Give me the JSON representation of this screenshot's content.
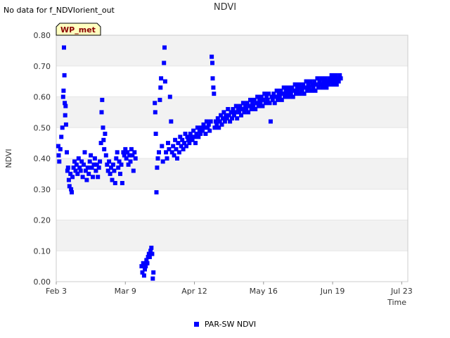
{
  "header": {
    "nodata_text": "No data for f_NDVIorient_out",
    "title": "NDVI"
  },
  "badge": {
    "label": "WP_met"
  },
  "legend": {
    "label": "PAR-SW NDVI",
    "color": "#0000ff"
  },
  "chart_data": {
    "type": "scatter",
    "title": "NDVI",
    "xlabel": "Time",
    "ylabel": "NDVI",
    "ylim": [
      0,
      0.8
    ],
    "yticks": [
      "0.00",
      "0.10",
      "0.20",
      "0.30",
      "0.40",
      "0.50",
      "0.60",
      "0.70",
      "0.80"
    ],
    "xlim_days_from_feb3": [
      0,
      173
    ],
    "xticks": [
      {
        "label": "Feb 3",
        "day": 0
      },
      {
        "label": "Mar 9",
        "day": 34
      },
      {
        "label": "Apr 12",
        "day": 68
      },
      {
        "label": "May 16",
        "day": 102
      },
      {
        "label": "Jun 19",
        "day": 136
      },
      {
        "label": "Jul 23",
        "day": 170
      }
    ],
    "grid": "horizontal bands",
    "series": [
      {
        "name": "PAR-SW NDVI",
        "color": "#0000ff",
        "points": [
          [
            1.0,
            0.44
          ],
          [
            1.2,
            0.41
          ],
          [
            1.5,
            0.39
          ],
          [
            2.0,
            0.43
          ],
          [
            2.5,
            0.47
          ],
          [
            3.0,
            0.5
          ],
          [
            3.4,
            0.6
          ],
          [
            3.6,
            0.62
          ],
          [
            3.8,
            0.76
          ],
          [
            4.0,
            0.67
          ],
          [
            4.2,
            0.58
          ],
          [
            4.4,
            0.54
          ],
          [
            4.6,
            0.57
          ],
          [
            4.8,
            0.51
          ],
          [
            5.2,
            0.42
          ],
          [
            5.5,
            0.36
          ],
          [
            5.8,
            0.37
          ],
          [
            6.2,
            0.33
          ],
          [
            6.5,
            0.31
          ],
          [
            7.0,
            0.35
          ],
          [
            7.3,
            0.3
          ],
          [
            7.6,
            0.29
          ],
          [
            8.0,
            0.34
          ],
          [
            8.5,
            0.37
          ],
          [
            9.0,
            0.39
          ],
          [
            9.5,
            0.36
          ],
          [
            10,
            0.38
          ],
          [
            10.5,
            0.35
          ],
          [
            11,
            0.4
          ],
          [
            11.5,
            0.37
          ],
          [
            12,
            0.36
          ],
          [
            12.5,
            0.39
          ],
          [
            13,
            0.34
          ],
          [
            13.5,
            0.38
          ],
          [
            14,
            0.42
          ],
          [
            14.5,
            0.36
          ],
          [
            15,
            0.33
          ],
          [
            15.5,
            0.37
          ],
          [
            16,
            0.35
          ],
          [
            16.5,
            0.39
          ],
          [
            17,
            0.41
          ],
          [
            17.5,
            0.37
          ],
          [
            18,
            0.34
          ],
          [
            18.5,
            0.38
          ],
          [
            19,
            0.4
          ],
          [
            19.5,
            0.36
          ],
          [
            20,
            0.38
          ],
          [
            20.5,
            0.34
          ],
          [
            21,
            0.37
          ],
          [
            21.5,
            0.39
          ],
          [
            22,
            0.45
          ],
          [
            22.3,
            0.55
          ],
          [
            22.6,
            0.59
          ],
          [
            23,
            0.5
          ],
          [
            23.3,
            0.46
          ],
          [
            23.6,
            0.43
          ],
          [
            24,
            0.48
          ],
          [
            24.5,
            0.41
          ],
          [
            25,
            0.38
          ],
          [
            25.5,
            0.36
          ],
          [
            26,
            0.39
          ],
          [
            26.5,
            0.35
          ],
          [
            27,
            0.37
          ],
          [
            27.5,
            0.33
          ],
          [
            28,
            0.38
          ],
          [
            28.5,
            0.36
          ],
          [
            29,
            0.32
          ],
          [
            29.5,
            0.4
          ],
          [
            30,
            0.42
          ],
          [
            30.5,
            0.37
          ],
          [
            31,
            0.39
          ],
          [
            31.5,
            0.35
          ],
          [
            32,
            0.38
          ],
          [
            32.5,
            0.32
          ],
          [
            33,
            0.42
          ],
          [
            33.5,
            0.41
          ],
          [
            34,
            0.43
          ],
          [
            34.5,
            0.4
          ],
          [
            35,
            0.42
          ],
          [
            35.5,
            0.38
          ],
          [
            36,
            0.41
          ],
          [
            36.5,
            0.39
          ],
          [
            37,
            0.43
          ],
          [
            37.5,
            0.41
          ],
          [
            38,
            0.36
          ],
          [
            38.5,
            0.42
          ],
          [
            39,
            0.4
          ],
          [
            42,
            0.05
          ],
          [
            42.4,
            0.03
          ],
          [
            42.8,
            0.06
          ],
          [
            43.2,
            0.02
          ],
          [
            43.6,
            0.04
          ],
          [
            44,
            0.05
          ],
          [
            44.4,
            0.07
          ],
          [
            44.8,
            0.06
          ],
          [
            45.2,
            0.08
          ],
          [
            45.6,
            0.09
          ],
          [
            46,
            0.08
          ],
          [
            46.4,
            0.1
          ],
          [
            46.8,
            0.11
          ],
          [
            47.2,
            0.09
          ],
          [
            47.5,
            0.01
          ],
          [
            47.8,
            0.03
          ],
          [
            48.5,
            0.58
          ],
          [
            48.7,
            0.55
          ],
          [
            49,
            0.48
          ],
          [
            49.3,
            0.29
          ],
          [
            49.6,
            0.37
          ],
          [
            50,
            0.4
          ],
          [
            50.5,
            0.42
          ],
          [
            51,
            0.59
          ],
          [
            51.3,
            0.63
          ],
          [
            51.6,
            0.66
          ],
          [
            52,
            0.44
          ],
          [
            52.5,
            0.39
          ],
          [
            53,
            0.71
          ],
          [
            53.3,
            0.76
          ],
          [
            53.6,
            0.65
          ],
          [
            54,
            0.42
          ],
          [
            54.5,
            0.4
          ],
          [
            55,
            0.45
          ],
          [
            55.5,
            0.43
          ],
          [
            56,
            0.6
          ],
          [
            56.5,
            0.52
          ],
          [
            57,
            0.42
          ],
          [
            57.5,
            0.44
          ],
          [
            58,
            0.41
          ],
          [
            58.5,
            0.46
          ],
          [
            59,
            0.43
          ],
          [
            59.5,
            0.4
          ],
          [
            60,
            0.45
          ],
          [
            60.5,
            0.42
          ],
          [
            61,
            0.47
          ],
          [
            61.5,
            0.44
          ],
          [
            62,
            0.46
          ],
          [
            62.5,
            0.43
          ],
          [
            63,
            0.45
          ],
          [
            63.5,
            0.48
          ],
          [
            64,
            0.44
          ],
          [
            64.5,
            0.47
          ],
          [
            65,
            0.46
          ],
          [
            65.5,
            0.45
          ],
          [
            66,
            0.48
          ],
          [
            66.5,
            0.47
          ],
          [
            67,
            0.46
          ],
          [
            67.5,
            0.49
          ],
          [
            68,
            0.47
          ],
          [
            68.5,
            0.45
          ],
          [
            69,
            0.48
          ],
          [
            69.5,
            0.5
          ],
          [
            70,
            0.47
          ],
          [
            70.5,
            0.49
          ],
          [
            71,
            0.48
          ],
          [
            71.5,
            0.5
          ],
          [
            72,
            0.49
          ],
          [
            72.5,
            0.51
          ],
          [
            73,
            0.5
          ],
          [
            73.5,
            0.48
          ],
          [
            74,
            0.52
          ],
          [
            74.5,
            0.5
          ],
          [
            75,
            0.51
          ],
          [
            75.5,
            0.49
          ],
          [
            76,
            0.52
          ],
          [
            76.5,
            0.73
          ],
          [
            76.8,
            0.71
          ],
          [
            77,
            0.66
          ],
          [
            77.3,
            0.63
          ],
          [
            77.6,
            0.61
          ],
          [
            78,
            0.5
          ],
          [
            78.5,
            0.52
          ],
          [
            79,
            0.51
          ],
          [
            79.5,
            0.53
          ],
          [
            80,
            0.5
          ],
          [
            80.5,
            0.52
          ],
          [
            81,
            0.54
          ],
          [
            81.5,
            0.51
          ],
          [
            82,
            0.53
          ],
          [
            82.5,
            0.55
          ],
          [
            83,
            0.52
          ],
          [
            83.5,
            0.54
          ],
          [
            84,
            0.53
          ],
          [
            84.5,
            0.56
          ],
          [
            85,
            0.54
          ],
          [
            85.5,
            0.52
          ],
          [
            86,
            0.55
          ],
          [
            86.5,
            0.53
          ],
          [
            87,
            0.56
          ],
          [
            87.5,
            0.54
          ],
          [
            88,
            0.55
          ],
          [
            88.5,
            0.57
          ],
          [
            89,
            0.53
          ],
          [
            89.5,
            0.56
          ],
          [
            90,
            0.55
          ],
          [
            90.5,
            0.57
          ],
          [
            91,
            0.54
          ],
          [
            91.5,
            0.56
          ],
          [
            92,
            0.58
          ],
          [
            92.5,
            0.55
          ],
          [
            93,
            0.57
          ],
          [
            93.5,
            0.56
          ],
          [
            94,
            0.58
          ],
          [
            94.5,
            0.55
          ],
          [
            95,
            0.57
          ],
          [
            95.5,
            0.59
          ],
          [
            96,
            0.56
          ],
          [
            96.5,
            0.58
          ],
          [
            97,
            0.57
          ],
          [
            97.5,
            0.59
          ],
          [
            98,
            0.56
          ],
          [
            98.5,
            0.58
          ],
          [
            99,
            0.6
          ],
          [
            99.5,
            0.57
          ],
          [
            100,
            0.59
          ],
          [
            100.5,
            0.58
          ],
          [
            101,
            0.6
          ],
          [
            101.5,
            0.57
          ],
          [
            102,
            0.59
          ],
          [
            102.5,
            0.61
          ],
          [
            103,
            0.58
          ],
          [
            103.5,
            0.6
          ],
          [
            104,
            0.59
          ],
          [
            104.5,
            0.61
          ],
          [
            105,
            0.58
          ],
          [
            105.5,
            0.52
          ],
          [
            106,
            0.6
          ],
          [
            106.5,
            0.59
          ],
          [
            107,
            0.61
          ],
          [
            107.5,
            0.58
          ],
          [
            108,
            0.6
          ],
          [
            108.5,
            0.62
          ],
          [
            109,
            0.59
          ],
          [
            109.5,
            0.61
          ],
          [
            110,
            0.6
          ],
          [
            110.5,
            0.62
          ],
          [
            111,
            0.59
          ],
          [
            111.5,
            0.61
          ],
          [
            112,
            0.63
          ],
          [
            112.5,
            0.6
          ],
          [
            113,
            0.62
          ],
          [
            113.5,
            0.61
          ],
          [
            114,
            0.63
          ],
          [
            114.5,
            0.6
          ],
          [
            115,
            0.62
          ],
          [
            115.5,
            0.61
          ],
          [
            116,
            0.63
          ],
          [
            116.5,
            0.6
          ],
          [
            117,
            0.62
          ],
          [
            117.5,
            0.64
          ],
          [
            118,
            0.61
          ],
          [
            118.5,
            0.63
          ],
          [
            119,
            0.62
          ],
          [
            119.5,
            0.64
          ],
          [
            120,
            0.61
          ],
          [
            120.5,
            0.63
          ],
          [
            121,
            0.62
          ],
          [
            121.5,
            0.64
          ],
          [
            122,
            0.61
          ],
          [
            122.5,
            0.63
          ],
          [
            123,
            0.65
          ],
          [
            123.5,
            0.62
          ],
          [
            124,
            0.64
          ],
          [
            124.5,
            0.63
          ],
          [
            125,
            0.65
          ],
          [
            125.5,
            0.62
          ],
          [
            126,
            0.64
          ],
          [
            126.5,
            0.63
          ],
          [
            127,
            0.65
          ],
          [
            127.5,
            0.62
          ],
          [
            128,
            0.64
          ],
          [
            128.5,
            0.66
          ],
          [
            129,
            0.63
          ],
          [
            129.5,
            0.65
          ],
          [
            130,
            0.64
          ],
          [
            130.5,
            0.66
          ],
          [
            131,
            0.63
          ],
          [
            131.5,
            0.65
          ],
          [
            132,
            0.64
          ],
          [
            132.5,
            0.66
          ],
          [
            133,
            0.63
          ],
          [
            133.5,
            0.65
          ],
          [
            134,
            0.64
          ],
          [
            134.5,
            0.66
          ],
          [
            135,
            0.65
          ],
          [
            135.5,
            0.67
          ],
          [
            136,
            0.64
          ],
          [
            136.5,
            0.66
          ],
          [
            137,
            0.65
          ],
          [
            137.5,
            0.67
          ],
          [
            138,
            0.64
          ],
          [
            138.5,
            0.66
          ],
          [
            139,
            0.65
          ],
          [
            139.5,
            0.67
          ],
          [
            140,
            0.66
          ]
        ]
      }
    ]
  }
}
